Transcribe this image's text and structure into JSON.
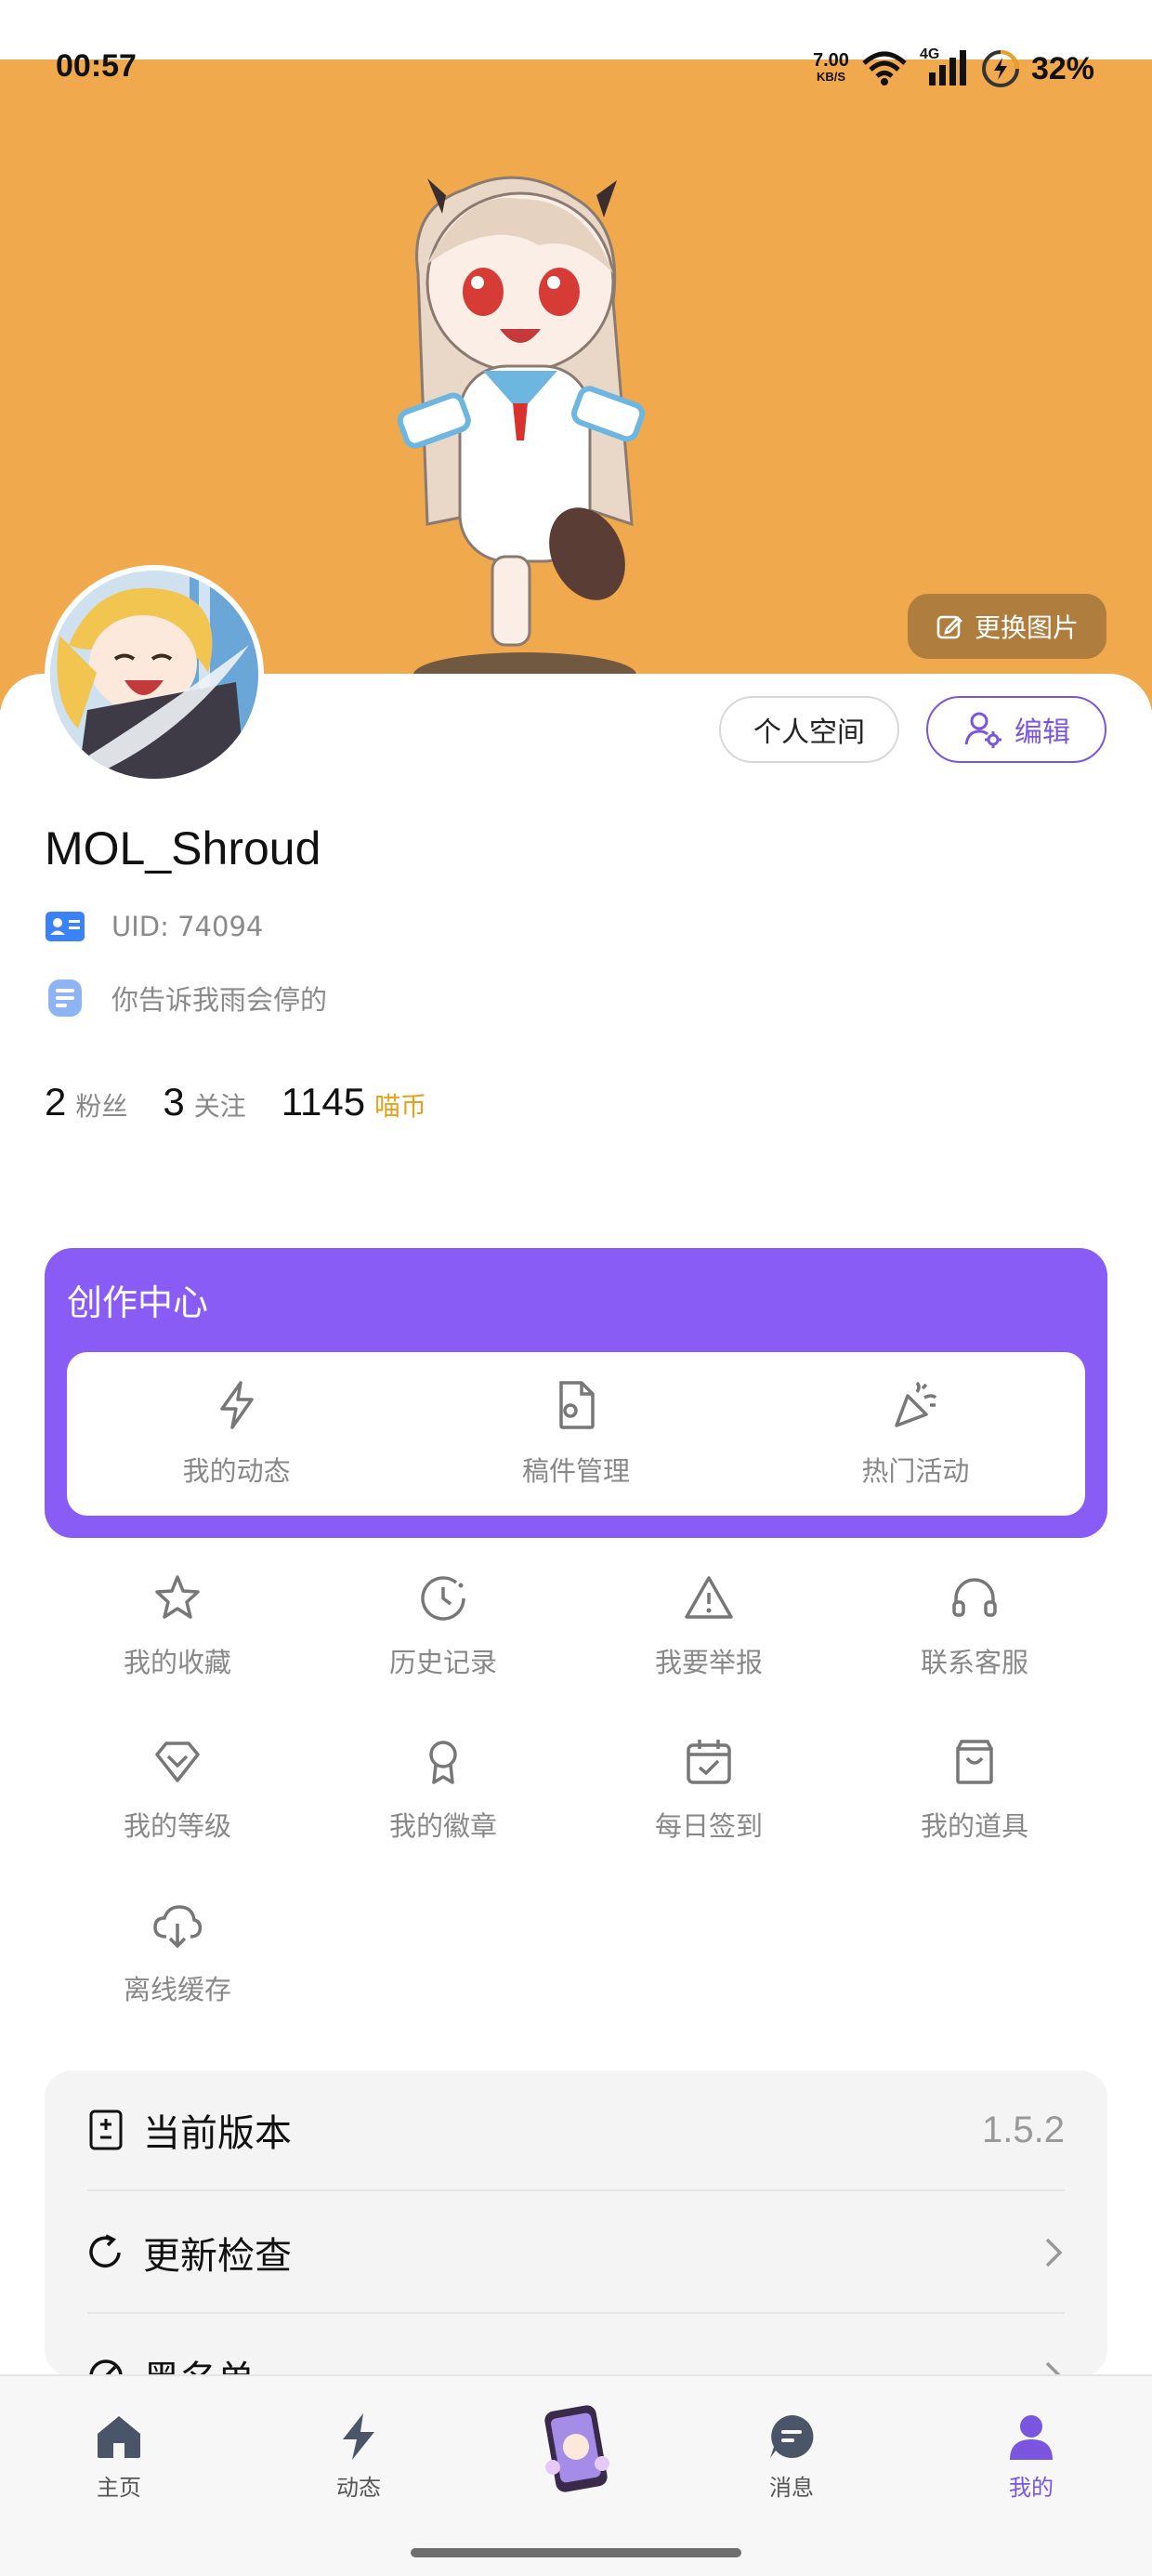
{
  "status_bar": {
    "time": "00:57",
    "net_speed": "7.00",
    "net_unit": "KB/S",
    "signal_label": "4G",
    "battery": "32%"
  },
  "header": {
    "change_image_label": "更换图片"
  },
  "profile": {
    "space_button": "个人空间",
    "edit_button": "编辑",
    "username": "MOL_Shroud",
    "uid": "UID: 74094",
    "signature": "你告诉我雨会停的",
    "followers_count": "2",
    "followers_label": "粉丝",
    "following_count": "3",
    "following_label": "关注",
    "coins_count": "1145",
    "coins_label": "喵币"
  },
  "creator_center": {
    "title": "创作中心",
    "items": [
      {
        "label": "我的动态",
        "icon": "lightning-icon"
      },
      {
        "label": "稿件管理",
        "icon": "file-settings-icon"
      },
      {
        "label": "热门活动",
        "icon": "party-popper-icon"
      }
    ]
  },
  "grid": {
    "items": [
      {
        "label": "我的收藏",
        "icon": "star-icon"
      },
      {
        "label": "历史记录",
        "icon": "history-icon"
      },
      {
        "label": "我要举报",
        "icon": "warning-icon"
      },
      {
        "label": "联系客服",
        "icon": "headset-icon"
      },
      {
        "label": "我的等级",
        "icon": "diamond-icon"
      },
      {
        "label": "我的徽章",
        "icon": "badge-icon"
      },
      {
        "label": "每日签到",
        "icon": "calendar-check-icon"
      },
      {
        "label": "我的道具",
        "icon": "bag-icon"
      },
      {
        "label": "离线缓存",
        "icon": "cloud-download-icon"
      }
    ]
  },
  "settings": {
    "version_label": "当前版本",
    "version_value": "1.5.2",
    "update_label": "更新检查",
    "blacklist_label": "黑名单"
  },
  "bottom_nav": {
    "items": [
      {
        "label": "主页",
        "icon": "home-icon"
      },
      {
        "label": "动态",
        "icon": "lightning-icon"
      },
      {
        "label": "消息",
        "icon": "message-icon"
      },
      {
        "label": "我的",
        "icon": "user-icon"
      }
    ],
    "active_color": "#7a55e0"
  },
  "colors": {
    "banner": "#f1a94e",
    "accent": "#8a5cf6",
    "coin": "#e6a21c"
  }
}
